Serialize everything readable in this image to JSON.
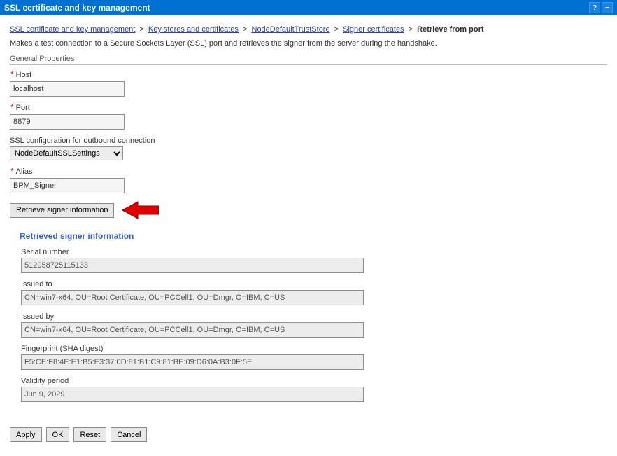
{
  "titlebar": {
    "title": "SSL certificate and key management"
  },
  "breadcrumb": {
    "items": [
      "SSL certificate and key management",
      "Key stores and certificates",
      "NodeDefaultTrustStore",
      "Signer certificates"
    ],
    "current": "Retrieve from port"
  },
  "description": "Makes a test connection to a Secure Sockets Layer (SSL) port and retrieves the signer from the server during the handshake.",
  "section_title": "General Properties",
  "fields": {
    "host_label": "Host",
    "host_value": "localhost",
    "port_label": "Port",
    "port_value": "8879",
    "sslconf_label": "SSL configuration for outbound connection",
    "sslconf_value": "NodeDefaultSSLSettings",
    "alias_label": "Alias",
    "alias_value": "BPM_Signer"
  },
  "retrieve_button": "Retrieve signer information",
  "retrieved": {
    "heading": "Retrieved signer information",
    "serial_label": "Serial number",
    "serial_value": "512058725115133",
    "issuedto_label": "Issued to",
    "issuedto_value": "CN=win7-x64, OU=Root Certificate, OU=PCCell1, OU=Dmgr, O=IBM, C=US",
    "issuedby_label": "Issued by",
    "issuedby_value": "CN=win7-x64, OU=Root Certificate, OU=PCCell1, OU=Dmgr, O=IBM, C=US",
    "fingerprint_label": "Fingerprint (SHA digest)",
    "fingerprint_value": "F5:CE:F8:4E:E1:B5:E3:37:0D:81:B1:C9:81:BE:09:D6:0A:B3:0F:5E",
    "validity_label": "Validity period",
    "validity_value": "Jun 9, 2029"
  },
  "buttons": {
    "apply": "Apply",
    "ok": "OK",
    "reset": "Reset",
    "cancel": "Cancel"
  }
}
